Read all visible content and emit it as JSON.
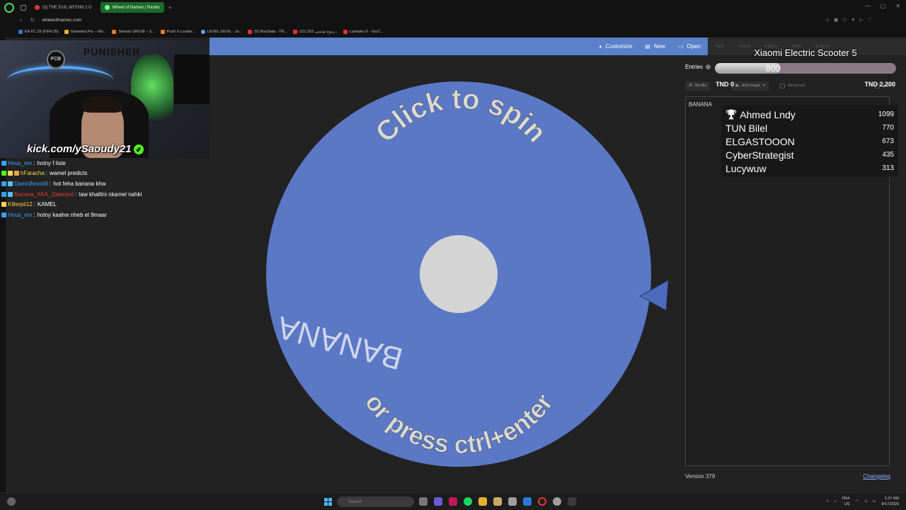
{
  "browser": {
    "tabs": [
      {
        "label": "(3) THE EVIL WITHIN 2 G",
        "active": false
      },
      {
        "label": "Wheel of Names | Rando",
        "active": true
      }
    ],
    "url": "wheelofnames.com",
    "bookmarks": [
      "EA FC 25 (FIFA 25)",
      "Gamekot.Pro – Mo...",
      "Stream GRIVØ – S...",
      "Push It Louder...",
      "LEVEL DEVIL - Jo...",
      "(5) Bos3ada - TR...",
      "(21) ربوع تونسي 201...",
      "Lashpiro 9 - YouT..."
    ]
  },
  "navbar": {
    "customize": "Customize",
    "new": "New",
    "open": "Open",
    "save": "Save",
    "share": "Share",
    "gallery": "Gallery",
    "more": "More",
    "language": "English"
  },
  "wheel": {
    "color": "#5a78c6",
    "top_text": "Click to spin",
    "bottom_text": "or press ctrl+enter",
    "entry": "BANANA"
  },
  "sidebar": {
    "tab": "Entries",
    "shuffle": "Shuffle",
    "add_image": "Add image",
    "advanced": "Advanced",
    "hide": "Hide",
    "entries": [
      "BANANA"
    ],
    "version": "Version 379",
    "changelog": "Changelog"
  },
  "stream": {
    "handle": "kick.com/ySaoudy21",
    "cam_logo1": "FCB",
    "cam_logo2": "PUNISHER",
    "chat": [
      {
        "user": "Hous_em",
        "color": "#3aa0ff",
        "badges": [
          "#3aa0ff"
        ],
        "message": "hotny f liste"
      },
      {
        "user": "hFaracha",
        "color": "#ffd54a",
        "badges": [
          "#53fc18",
          "#ffd54a",
          "#e0a84a"
        ],
        "message": "wamel predicts"
      },
      {
        "user": "DamnBoss69",
        "color": "#3aa0ff",
        "badges": [
          "#3aa0ff",
          "#53c0ff"
        ],
        "message": "hot feha banana khw"
      },
      {
        "user": "Banana_AKA_Zabarjed",
        "color": "#e53935",
        "badges": [
          "#3aa0ff",
          "#53c0ff"
        ],
        "message": "taw khalitni nkamel nahki"
      },
      {
        "user": "Killerpii12",
        "color": "#ffd54a",
        "badges": [
          "#ffd54a"
        ],
        "message": "KAMEL"
      },
      {
        "user": "Hous_em",
        "color": "#3aa0ff",
        "badges": [
          "#3aa0ff"
        ],
        "message": "hotny kaahw nheb el 9maar"
      }
    ]
  },
  "goal": {
    "title": "Xiaomi Electric Scooter 5",
    "current": "800",
    "current_value": 800,
    "max_value": 2200,
    "min_label": "TND 0",
    "max_label": "TND 2,200"
  },
  "leaderboard": [
    {
      "name": "Ahmed Lndy",
      "score": "1099",
      "trophy": true
    },
    {
      "name": "TUN Bilel",
      "score": "770"
    },
    {
      "name": "ELGASTOOON",
      "score": "673"
    },
    {
      "name": "CyberStrategist",
      "score": "435"
    },
    {
      "name": "Lucywuw",
      "score": "313"
    }
  ],
  "taskbar": {
    "search_placeholder": "Search",
    "lang": "FRA",
    "region": "US",
    "time": "1:37 AM",
    "date": "9/17/2025"
  }
}
